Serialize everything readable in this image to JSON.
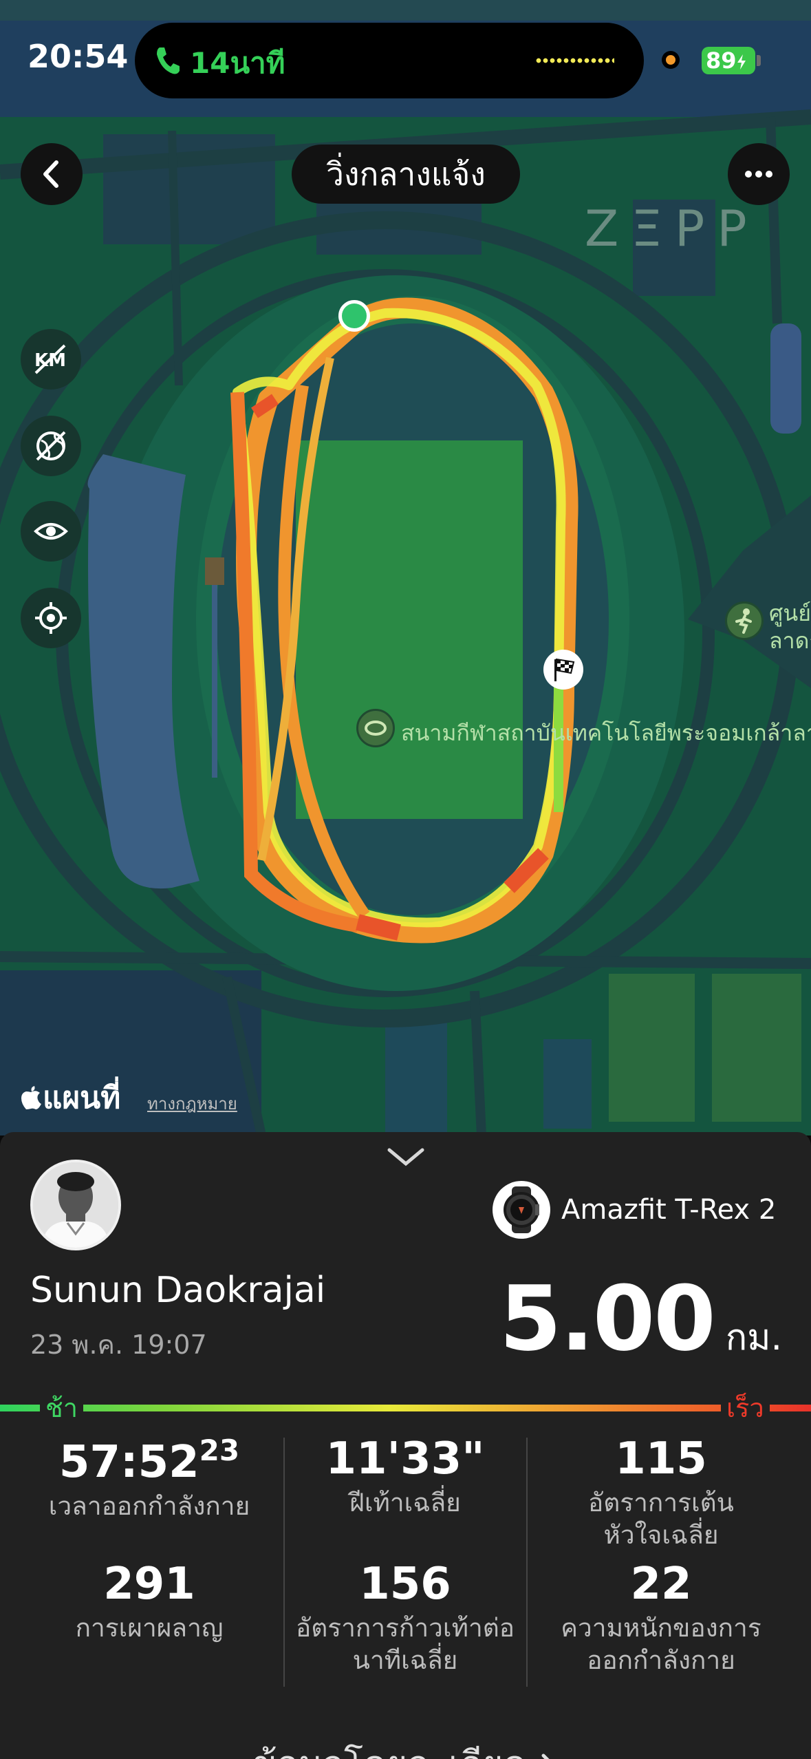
{
  "status_bar": {
    "time": "20:54",
    "call_duration": "14นาที",
    "battery": "89"
  },
  "map": {
    "title": "วิ่งกลางแจ้ง",
    "brand": "ZΞPP",
    "poi_stadium": "สนามกีฬาสถาบันเทคโนโลยีพระจอมเกล้าลาดก",
    "poi_center_line1": "ศูนย์",
    "poi_center_line2": "ลาดก",
    "maps_label": "แผนที่",
    "legal": "ทางกฎหมาย",
    "colors": {
      "route_fast": "#ee6a2a",
      "route_mid": "#f3a33a",
      "route_slow": "#e6ea3d",
      "start": "#2fc36c"
    }
  },
  "workout": {
    "user_name": "Sunun Daokrajai",
    "date": "23 พ.ค. 19:07",
    "device": "Amazfit T-Rex 2",
    "distance": "5.00",
    "distance_unit": "กม.",
    "pace_slow": "ช้า",
    "pace_fast": "เร็ว",
    "stats": [
      {
        "value": "57:52",
        "value_sup": "23",
        "label1": "เวลาออกกำลังกาย",
        "label2": ""
      },
      {
        "value": "11'33\"",
        "value_sup": "",
        "label1": "ฝีเท้าเฉลี่ย",
        "label2": ""
      },
      {
        "value": "115",
        "value_sup": "",
        "label1": "อัตราการเต้น",
        "label2": "หัวใจเฉลี่ย"
      },
      {
        "value": "291",
        "value_sup": "",
        "label1": "การเผาผลาญ",
        "label2": ""
      },
      {
        "value": "156",
        "value_sup": "",
        "label1": "อัตราการก้าวเท้าต่อ",
        "label2": "นาทีเฉลี่ย"
      },
      {
        "value": "22",
        "value_sup": "",
        "label1": "ความหนักของการ",
        "label2": "ออกกำลังกาย"
      }
    ],
    "details_link": "ข้อมูลโดยละเอียด"
  }
}
